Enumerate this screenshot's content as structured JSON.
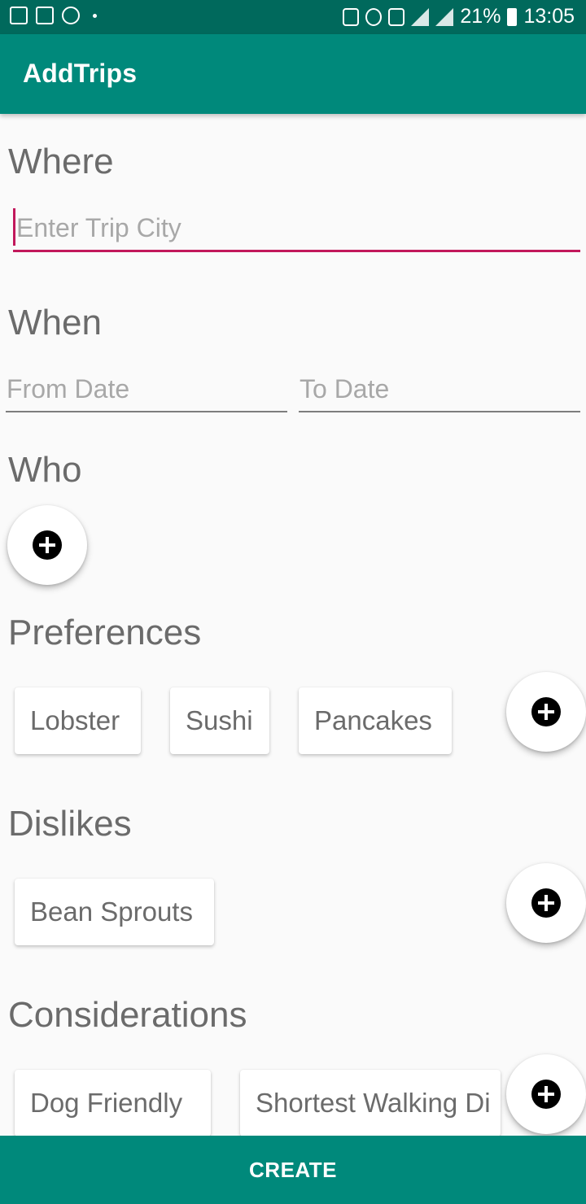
{
  "status_bar": {
    "battery": "21%",
    "time": "13:05",
    "left_icons": [
      "image-icon",
      "gmail-icon",
      "sync-icon"
    ],
    "right_icons": [
      "mute-icon",
      "alarm-icon",
      "nfc-icon",
      "signal-icon",
      "data-icon",
      "signal-icon",
      "battery-icon"
    ]
  },
  "app_bar": {
    "title": "AddTrips"
  },
  "where": {
    "title": "Where",
    "city_placeholder": "Enter Trip City"
  },
  "when": {
    "title": "When",
    "from_placeholder": "From Date",
    "to_placeholder": "To Date"
  },
  "who": {
    "title": "Who"
  },
  "preferences": {
    "title": "Preferences",
    "items": [
      "Lobster",
      "Sushi",
      "Pancakes"
    ]
  },
  "dislikes": {
    "title": "Dislikes",
    "items": [
      "Bean Sprouts"
    ]
  },
  "considerations": {
    "title": "Considerations",
    "items": [
      "Dog Friendly",
      "Shortest Walking Di"
    ]
  },
  "create_button": {
    "label": "CREATE"
  },
  "colors": {
    "primary": "#00897b",
    "primary_dark": "#00695c",
    "accent": "#c2185b"
  }
}
